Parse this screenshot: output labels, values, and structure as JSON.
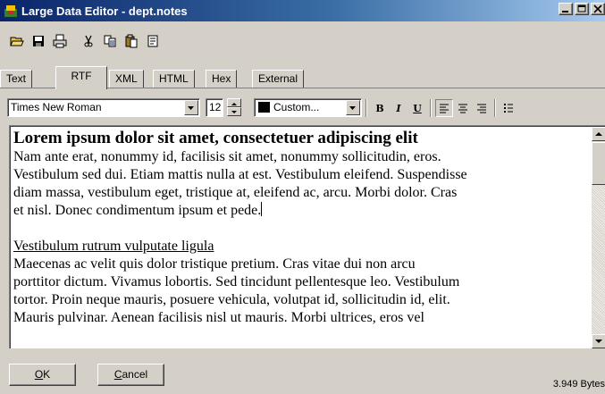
{
  "window": {
    "title": "Large Data Editor - dept.notes",
    "buttons": [
      "minimize",
      "maximize",
      "close"
    ]
  },
  "toolbar": {
    "icons": [
      "open-icon",
      "save-icon",
      "print-icon",
      "cut-icon",
      "copy-icon",
      "paste-icon",
      "properties-icon"
    ]
  },
  "tabs": [
    {
      "label": "Text"
    },
    {
      "label": "RTF",
      "active": true
    },
    {
      "label": "XML"
    },
    {
      "label": "HTML"
    },
    {
      "label": "Hex"
    },
    {
      "label": "External"
    }
  ],
  "format": {
    "font_name": "Times New Roman",
    "font_size": "12",
    "color_label": "Custom...",
    "color_swatch": "#000000",
    "bold_label": "B",
    "italic_label": "I",
    "underline_label": "U"
  },
  "editor": {
    "heading": "Lorem ipsum dolor sit amet, consectetuer adipiscing elit",
    "lines1": [
      "Nam ante erat, nonummy id, facilisis sit amet, nonummy sollicitudin, eros.",
      "Vestibulum sed dui. Etiam mattis nulla at est. Vestibulum eleifend. Suspendisse",
      "diam massa, vestibulum eget, tristique at, eleifend ac, arcu. Morbi dolor. Cras",
      "et nisl. Donec condimentum ipsum et pede."
    ],
    "subheading": "Vestibulum rutrum vulputate ligula",
    "lines2": [
      "Maecenas ac velit quis dolor tristique pretium. Cras vitae dui non arcu",
      "porttitor dictum. Vivamus lobortis. Sed tincidunt pellentesque leo. Vestibulum",
      "tortor. Proin neque mauris, posuere vehicula, volutpat id, sollicitudin id, elit.",
      "Mauris pulvinar. Aenean facilisis nisl ut mauris. Morbi ultrices, eros vel"
    ]
  },
  "footer": {
    "ok_mnemonic": "O",
    "ok_rest": "K",
    "cancel_mnemonic": "C",
    "cancel_rest": "ancel",
    "status": "3.949 Bytes"
  }
}
